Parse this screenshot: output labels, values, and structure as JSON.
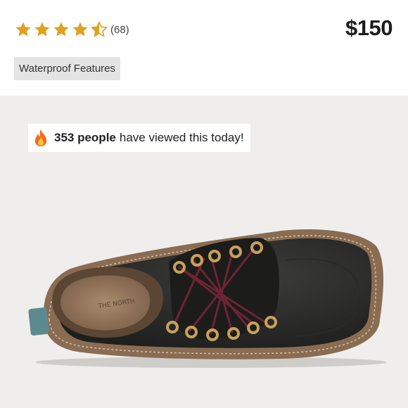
{
  "product": {
    "rating_count": "(68)",
    "rating_value": 4.5,
    "rating_max": 5,
    "price": "$150",
    "feature_tag": "Waterproof Features"
  },
  "banner": {
    "count": "353 people",
    "text": "have viewed this today!"
  },
  "colors": {
    "star": "#e0a020",
    "background": "#efeeed",
    "tag_bg": "#e4e4e4"
  },
  "icons": [
    "star-icon",
    "star-half-icon",
    "flame-icon"
  ]
}
